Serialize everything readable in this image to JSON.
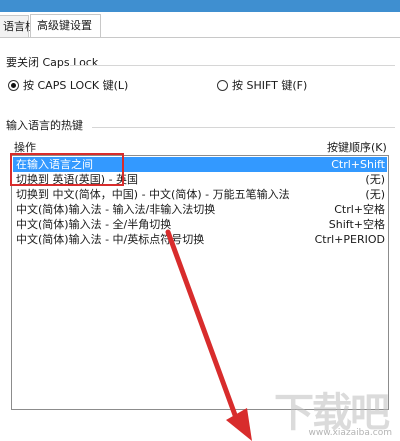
{
  "tabs": [
    {
      "label": "语言栏"
    },
    {
      "label": "高级键设置"
    }
  ],
  "caps_lock": {
    "title": "要关闭 Caps Lock",
    "options": [
      {
        "label": "按 CAPS LOCK 键(L)",
        "checked": true
      },
      {
        "label": "按 SHIFT 键(F)",
        "checked": false
      }
    ]
  },
  "hotkeys": {
    "title": "输入语言的热键",
    "col_action": "操作",
    "col_keys": "按键顺序(K)",
    "rows": [
      {
        "name": "在输入语言之间",
        "keys": "Ctrl+Shift",
        "selected": true
      },
      {
        "name": "切换到 英语(英国) - 英国",
        "keys": "(无)",
        "selected": false
      },
      {
        "name": "切换到 中文(简体，中国) - 中文(简体) - 万能五笔输入法",
        "keys": "(无)",
        "selected": false
      },
      {
        "name": "中文(简体)输入法 - 输入法/非输入法切换",
        "keys": "Ctrl+空格",
        "selected": false
      },
      {
        "name": "中文(简体)输入法 - 全/半角切换",
        "keys": "Shift+空格",
        "selected": false
      },
      {
        "name": "中文(简体)输入法 - 中/英标点符号切换",
        "keys": "Ctrl+PERIOD",
        "selected": false
      }
    ]
  },
  "watermark": {
    "text": "下载吧",
    "url": "www.xiazaiba.com"
  },
  "colors": {
    "accent": "#3399ff",
    "annotation": "#d82c2c"
  }
}
